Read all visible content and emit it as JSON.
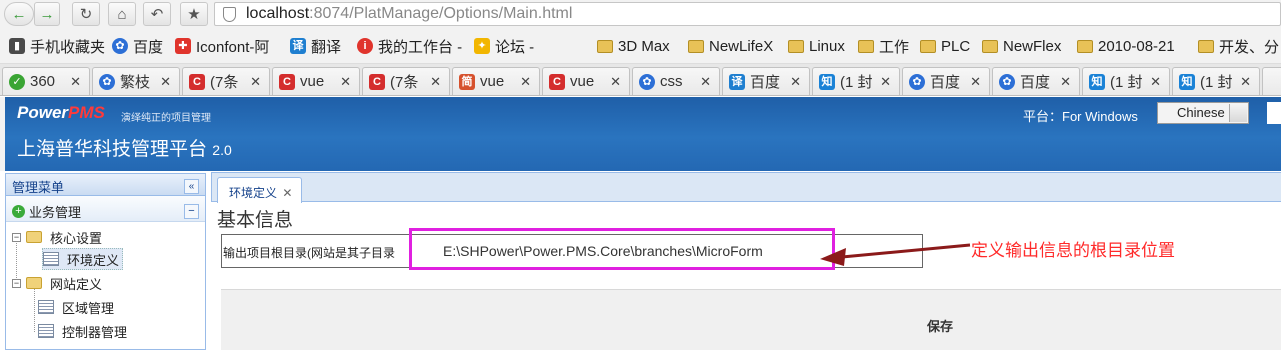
{
  "browser": {
    "url_host": "localhost",
    "url_rest": ":8074/PlatManage/Options/Main.html",
    "bookmarks": [
      {
        "label": "手机收藏夹",
        "icon": "phone-icon"
      },
      {
        "label": "百度",
        "icon": "baidu-paw-icon"
      },
      {
        "label": "Iconfont-阿",
        "icon": "iconfont-icon"
      },
      {
        "label": "翻译",
        "icon": "translate-icon"
      },
      {
        "label": "我的工作台 -",
        "icon": "workbench-icon"
      },
      {
        "label": "论坛 -",
        "icon": "forum-icon"
      },
      {
        "label": "3D Max",
        "icon": "folder-icon"
      },
      {
        "label": "NewLifeX",
        "icon": "folder-icon"
      },
      {
        "label": "Linux",
        "icon": "folder-icon"
      },
      {
        "label": "工作",
        "icon": "folder-icon"
      },
      {
        "label": "PLC",
        "icon": "folder-icon"
      },
      {
        "label": "NewFlex",
        "icon": "folder-icon"
      },
      {
        "label": "2010-08-21",
        "icon": "folder-icon"
      },
      {
        "label": "开发、分",
        "icon": "folder-icon"
      }
    ],
    "tabs": [
      {
        "label": "360",
        "icon_text": "✓"
      },
      {
        "label": "繁枝",
        "icon_text": "🐾"
      },
      {
        "label": "(7条",
        "icon_text": "C"
      },
      {
        "label": "vue",
        "icon_text": "C"
      },
      {
        "label": "(7条",
        "icon_text": "C"
      },
      {
        "label": "vue",
        "icon_text": "简"
      },
      {
        "label": "vue",
        "icon_text": "C"
      },
      {
        "label": "css",
        "icon_text": "🐾"
      },
      {
        "label": "百度",
        "icon_text": "译"
      },
      {
        "label": "(1 封",
        "icon_text": "知"
      },
      {
        "label": "百度",
        "icon_text": "🐾"
      },
      {
        "label": "百度",
        "icon_text": "🐾"
      },
      {
        "label": "(1 封",
        "icon_text": "知"
      },
      {
        "label": "(1 封",
        "icon_text": "知"
      }
    ]
  },
  "app": {
    "logo_power": "Power",
    "logo_pms": "PMS",
    "tagline": "演绎纯正的项目管理",
    "title": "上海普华科技管理平台",
    "version": "2.0",
    "platform": "平台：For Windows",
    "language": "Chinese"
  },
  "sidebar": {
    "header": "管理菜单",
    "section": "业务管理",
    "tree": [
      {
        "label": "核心设置",
        "type": "folder"
      },
      {
        "label": "环境定义",
        "type": "page",
        "selected": true
      },
      {
        "label": "网站定义",
        "type": "folder"
      },
      {
        "label": "区域管理",
        "type": "page"
      },
      {
        "label": "控制器管理",
        "type": "page"
      }
    ]
  },
  "content": {
    "tab_label": "环境定义",
    "section_title": "基本信息",
    "field_label": "输出项目根目录(网站是其子目录",
    "field_value": "E:\\SHPower\\Power.PMS.Core\\branches\\MicroForm",
    "save_label": "保存"
  },
  "annotation": {
    "text": "定义输出信息的根目录位置",
    "color": "#ff2a2a",
    "highlight_color": "#e020e0"
  }
}
